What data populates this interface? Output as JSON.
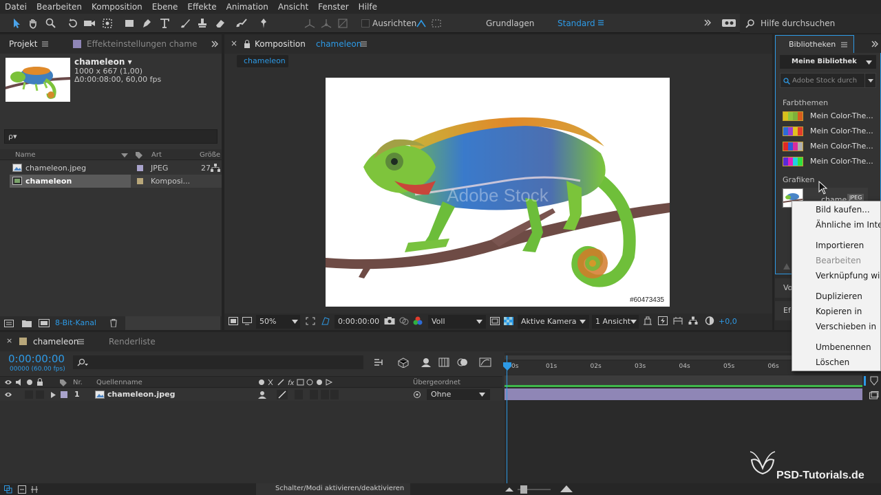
{
  "menu": [
    "Datei",
    "Bearbeiten",
    "Komposition",
    "Ebene",
    "Effekte",
    "Animation",
    "Ansicht",
    "Fenster",
    "Hilfe"
  ],
  "toolbar": {
    "snap_label": "Ausrichten",
    "workspace_basic": "Grundlagen",
    "workspace_standard": "Standard",
    "help_placeholder": "Hilfe durchsuchen"
  },
  "project": {
    "tab": "Projekt",
    "tab2": "Effekteinstellungen chameleon",
    "item_name": "chameleon ▾",
    "item_dims": "1000 x 667 (1,00)",
    "item_dur": "Δ0:00:08:00, 60,00 fps",
    "search_icon": "ρ▾",
    "col_name": "Name",
    "col_type": "Art",
    "col_size": "Größe",
    "rows": [
      {
        "name": "chameleon.jpeg",
        "type": "JPEG",
        "size": "27"
      },
      {
        "name": "chameleon",
        "type": "Komposi..."
      }
    ],
    "bitdepth": "8-Bit-Kanal"
  },
  "comp": {
    "tab_prefix": "Komposition",
    "tab_name": "chameleon",
    "subtab": "chameleon",
    "watermark": "Adobe Stock",
    "image_id": "#60473435",
    "zoom": "50%",
    "timecode": "0:00:00:00",
    "resolution": "Voll",
    "camera": "Aktive Kamera",
    "views": "1 Ansicht",
    "exposure": "+0,0"
  },
  "libraries": {
    "tab": "Bibliotheken",
    "library": "Meine Bibliothek",
    "search_placeholder": "Adobe Stock durch",
    "color_section": "Farbthemen",
    "themes": [
      {
        "label": "Mein Color-The...",
        "colors": [
          "#d7c21c",
          "#8ec63f",
          "#7fb03a",
          "#d85d1e"
        ]
      },
      {
        "label": "Mein Color-The...",
        "colors": [
          "#2d6bd6",
          "#9b3bd0",
          "#e0c020",
          "#e23c2c"
        ]
      },
      {
        "label": "Mein Color-The...",
        "colors": [
          "#e02828",
          "#2f5bd9",
          "#d92d9c",
          "#b0b0b0"
        ]
      },
      {
        "label": "Mein Color-The...",
        "colors": [
          "#5a2ad9",
          "#e020c0",
          "#20d0e0",
          "#30e040"
        ]
      }
    ],
    "graphics_section": "Grafiken",
    "graphic_label": "chamele",
    "graphic_badge": "JPEG",
    "panel_vo": "Vo",
    "panel_ef": "Ef"
  },
  "context_menu": [
    {
      "label": "Bild kaufen...",
      "enabled": true
    },
    {
      "label": "Ähnliche im Internet suchen",
      "enabled": true
    },
    {
      "sep": true
    },
    {
      "label": "Importieren",
      "enabled": true
    },
    {
      "label": "Bearbeiten",
      "enabled": false
    },
    {
      "label": "Verknüpfung wird kopiert",
      "enabled": true
    },
    {
      "sep": true
    },
    {
      "label": "Duplizieren",
      "enabled": true
    },
    {
      "label": "Kopieren in",
      "enabled": true
    },
    {
      "label": "Verschieben in",
      "enabled": true
    },
    {
      "sep": true
    },
    {
      "label": "Umbenennen",
      "enabled": true
    },
    {
      "label": "Löschen",
      "enabled": true
    }
  ],
  "timeline": {
    "tab": "chameleon",
    "tab2": "Renderliste",
    "timecode": "0:00:00:00",
    "frames": "00000 (60.00 fps)",
    "col_nr": "Nr.",
    "col_source": "Quellenname",
    "col_parent": "Übergeordnet",
    "layer_nr": "1",
    "layer_name": "chameleon.jpeg",
    "parent": "Ohne",
    "ruler": [
      "0s",
      "01s",
      "02s",
      "03s",
      "04s",
      "05s",
      "06s"
    ],
    "footer": "Schalter/Modi aktivieren/deaktivieren"
  },
  "watermark": "PSD-Tutorials.de",
  "colors": {
    "accent": "#2d9ae6",
    "layer_bar": "#8f86b6",
    "selection": "#4a4a4a"
  }
}
